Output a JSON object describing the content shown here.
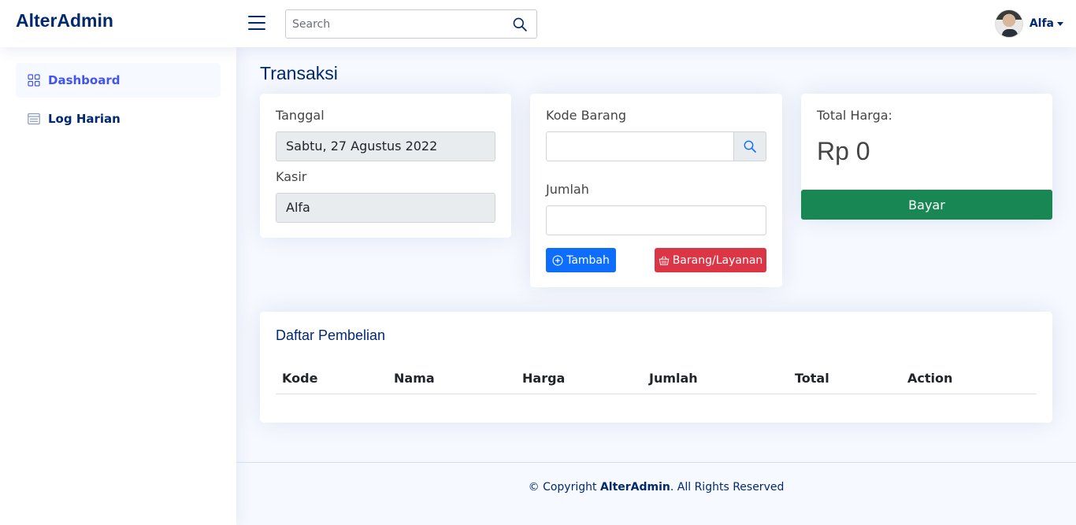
{
  "header": {
    "logo": "AlterAdmin",
    "search_placeholder": "Search",
    "profile_name": "Alfa"
  },
  "sidebar": {
    "items": [
      {
        "label": "Dashboard",
        "icon": "grid-icon",
        "active": true
      },
      {
        "label": "Log Harian",
        "icon": "layout-text-window-icon",
        "active": false
      }
    ]
  },
  "main": {
    "title": "Transaksi",
    "info_card": {
      "date_label": "Tanggal",
      "date_value": "Sabtu, 27 Agustus 2022",
      "cashier_label": "Kasir",
      "cashier_value": "Alfa"
    },
    "item_card": {
      "code_label": "Kode Barang",
      "code_value": "",
      "qty_label": "Jumlah",
      "qty_value": "",
      "add_button": "Tambah",
      "items_button": "Barang/Layanan"
    },
    "total_card": {
      "label": "Total Harga:",
      "value": "Rp 0",
      "pay_button": "Bayar"
    },
    "purchase_list": {
      "title": "Daftar Pembelian",
      "columns": [
        "Kode",
        "Nama",
        "Harga",
        "Jumlah",
        "Total",
        "Action"
      ],
      "rows": []
    }
  },
  "footer": {
    "prefix": "© Copyright ",
    "brand": "AlterAdmin",
    "suffix": ". All Rights Reserved"
  },
  "colors": {
    "primary": "#012970",
    "accent": "#4154f1",
    "blue_button": "#0d6efd",
    "red_button": "#dc3545",
    "green_button": "#198754"
  }
}
